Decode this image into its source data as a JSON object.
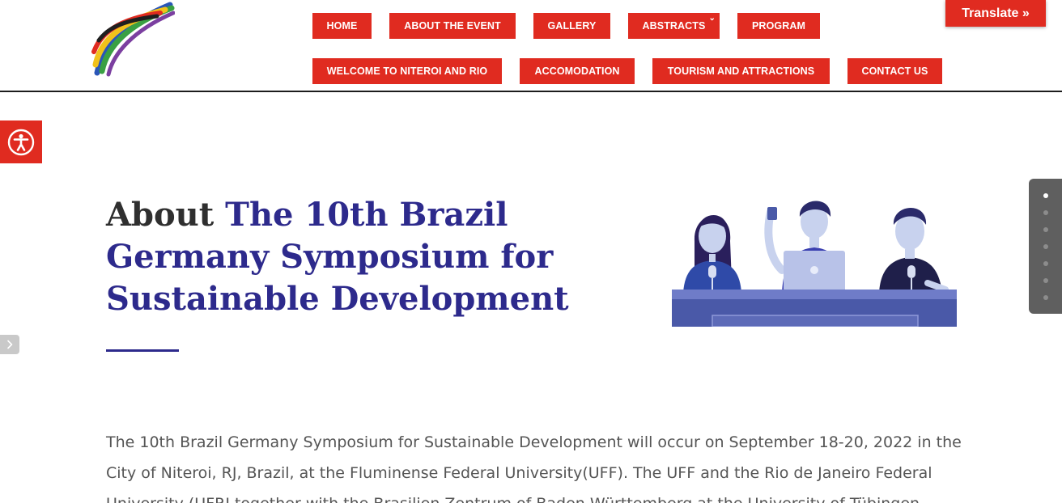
{
  "nav": {
    "row1": [
      {
        "label": "HOME"
      },
      {
        "label": "ABOUT THE EVENT"
      },
      {
        "label": "GALLERY"
      },
      {
        "label": "ABSTRACTS"
      },
      {
        "label": "PROGRAM"
      }
    ],
    "row2": [
      {
        "label": "WELCOME TO NITEROI AND RIO"
      },
      {
        "label": "ACCOMODATION"
      },
      {
        "label": "TOURISM AND ATTRACTIONS"
      },
      {
        "label": "CONTACT US"
      }
    ],
    "abstracts_caret": "⌄"
  },
  "translate": {
    "label": "Translate »"
  },
  "heading": {
    "prefix": "About ",
    "title": "The 10th Brazil Germany Symposium for Sustainable Development"
  },
  "intro": {
    "text": "The 10th Brazil Germany Symposium for Sustainable Development will occur on September 18-20, 2022 in the City of Niteroi, RJ, Brazil, at the Fluminense Federal University(UFF). The UFF and the Rio de Janeiro Federal University (UFRJ together with the Brasilien Zentrum of Baden-Württemberg at the University of Tübingen"
  },
  "dot_nav": {
    "count": 7,
    "active_index": 0
  },
  "colors": {
    "accent_red": "#e02b20",
    "heading_blue": "#2d2a8c",
    "body_text": "#555555"
  },
  "icons": {
    "accessibility": "accessibility-icon",
    "side_toggle": "chevron-right-icon",
    "logo": "symposium-logo"
  }
}
